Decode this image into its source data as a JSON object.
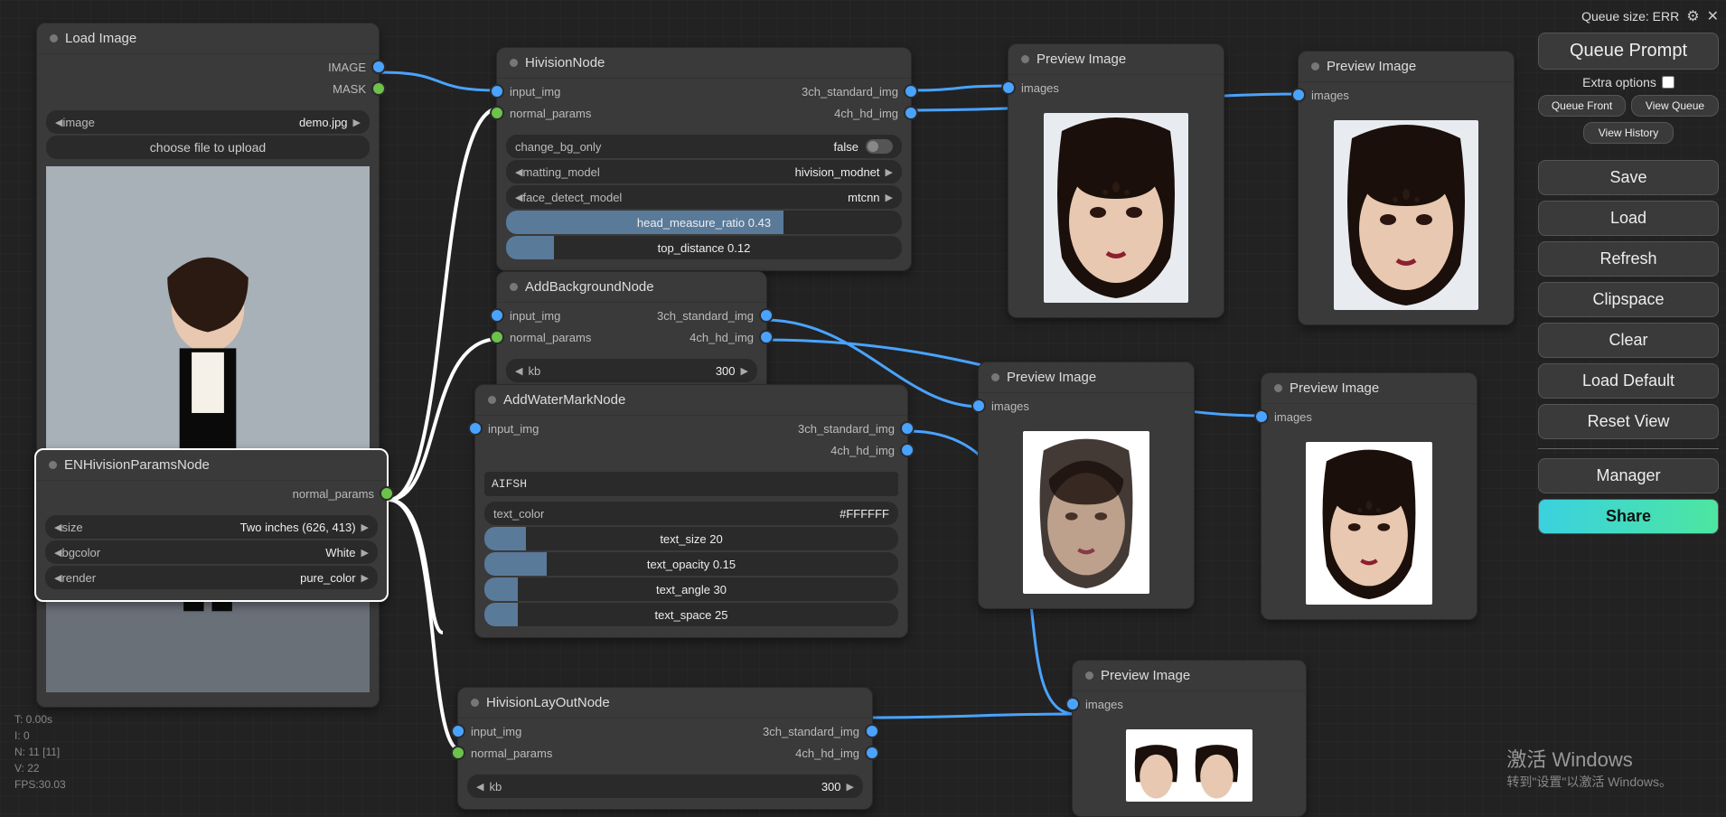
{
  "sidebar": {
    "queue_label": "Queue size: ERR",
    "queue_prompt": "Queue Prompt",
    "extra_options": "Extra options",
    "queue_front": "Queue Front",
    "view_queue": "View Queue",
    "view_history": "View History",
    "save": "Save",
    "load": "Load",
    "refresh": "Refresh",
    "clipspace": "Clipspace",
    "clear": "Clear",
    "load_default": "Load Default",
    "reset_view": "Reset View",
    "manager": "Manager",
    "share": "Share"
  },
  "nodes": {
    "load_image": {
      "title": "Load Image",
      "out_image": "IMAGE",
      "out_mask": "MASK",
      "combo_label": "image",
      "combo_value": "demo.jpg",
      "upload_btn": "choose file to upload"
    },
    "enh_params": {
      "title": "ENHivisionParamsNode",
      "out_normal_params": "normal_params",
      "size_label": "size",
      "size_value": "Two inches  (626, 413)",
      "bgcolor_label": "bgcolor",
      "bgcolor_value": "White",
      "render_label": "render",
      "render_value": "pure_color"
    },
    "hivision": {
      "title": "HivisionNode",
      "in_input_img": "input_img",
      "in_normal_params": "normal_params",
      "out_3ch": "3ch_standard_img",
      "out_4ch": "4ch_hd_img",
      "change_bg_label": "change_bg_only",
      "change_bg_value": "false",
      "matting_label": "matting_model",
      "matting_value": "hivision_modnet",
      "face_detect_label": "face_detect_model",
      "face_detect_value": "mtcnn",
      "head_ratio_label": "head_measure_ratio  0.43",
      "top_distance_label": "top_distance  0.12"
    },
    "add_bg": {
      "title": "AddBackgroundNode",
      "in_input_img": "input_img",
      "in_normal_params": "normal_params",
      "out_3ch": "3ch_standard_img",
      "out_4ch": "4ch_hd_img",
      "kb_label": "kb",
      "kb_value": "300"
    },
    "watermark": {
      "title": "AddWaterMarkNode",
      "in_input_img": "input_img",
      "out_3ch": "3ch_standard_img",
      "out_4ch": "4ch_hd_img",
      "text_value": "AIFSH",
      "text_color_label": "text_color",
      "text_color_value": "#FFFFFF",
      "text_size_label": "text_size  20",
      "text_opacity_label": "text_opacity  0.15",
      "text_angle_label": "text_angle  30",
      "text_space_label": "text_space  25"
    },
    "layout": {
      "title": "HivisionLayOutNode",
      "in_input_img": "input_img",
      "in_normal_params": "normal_params",
      "out_3ch": "3ch_standard_img",
      "out_4ch": "4ch_hd_img",
      "kb_label": "kb",
      "kb_value": "300"
    },
    "preview": {
      "title": "Preview Image",
      "in_images": "images"
    }
  },
  "stats": {
    "t": "T: 0.00s",
    "i": "I: 0",
    "n": "N: 11 [11]",
    "v": "V: 22",
    "fps": "FPS:30.03"
  },
  "watermark_win": {
    "l1": "激活 Windows",
    "l2": "转到\"设置\"以激活 Windows。"
  }
}
